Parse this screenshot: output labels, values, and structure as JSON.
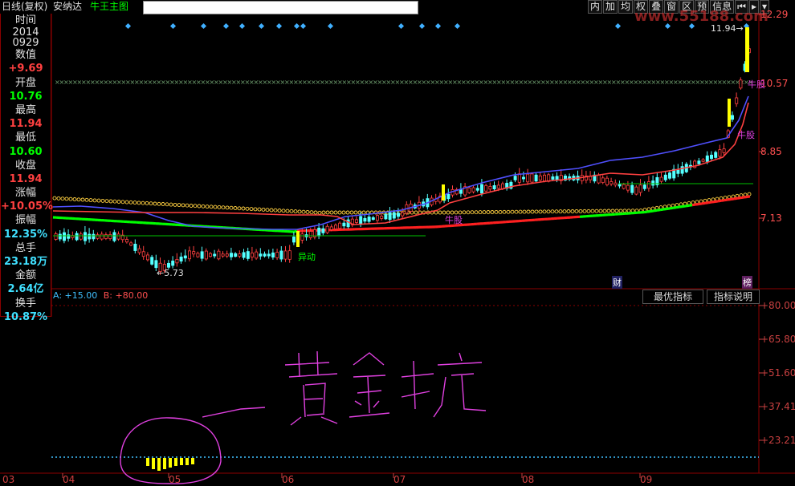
{
  "header": {
    "period": "日线(复权)",
    "stock_name": "安纳达",
    "indicator_name": "牛王主图",
    "search_value": "",
    "toolbar": [
      "内",
      "加",
      "均",
      "权",
      "叠",
      "窗",
      "区",
      "预",
      "信息"
    ],
    "watermark": "www.55188.com"
  },
  "info_panel": {
    "rows": [
      {
        "label": "时间",
        "value": "2014\n0929"
      },
      {
        "label": "数值",
        "value": "+9.69",
        "color": "#ff4040"
      },
      {
        "label": "开盘",
        "value": "10.76",
        "color": "#00ff00"
      },
      {
        "label": "最高",
        "value": "11.94",
        "color": "#ff4040"
      },
      {
        "label": "最低",
        "value": "10.60",
        "color": "#00ff00"
      },
      {
        "label": "收盘",
        "value": "11.94",
        "color": "#ff4040"
      },
      {
        "label": "涨幅",
        "value": "+10.05%",
        "color": "#ff4040"
      },
      {
        "label": "振幅",
        "value": "12.35%",
        "color": "#40e0ff"
      },
      {
        "label": "总手",
        "value": "23.18万",
        "color": "#40e0ff"
      },
      {
        "label": "金额",
        "value": "2.64亿",
        "color": "#40e0ff"
      },
      {
        "label": "换手",
        "value": "10.87%",
        "color": "#40e0ff"
      }
    ],
    "time_year": "2014",
    "time_date": "0929"
  },
  "price_axis": [
    "12.29",
    "10.57",
    "8.85",
    "7.13"
  ],
  "indicator_axis": [
    "+80.00",
    "+65.80",
    "+51.60",
    "+37.41",
    "+23.21"
  ],
  "date_axis": [
    "03",
    "04",
    "05",
    "06",
    "07",
    "08",
    "09"
  ],
  "annotations": {
    "high_label": "11.94",
    "low_label": "5.73",
    "yidong": "异动",
    "niugu1": "牛股",
    "niugu2": "牛股",
    "niugu3": "牛股",
    "cai": "财",
    "bang": "榜"
  },
  "indicator_values": {
    "a_label": "A:",
    "a_value": "+15.00",
    "b_label": "B:",
    "b_value": "+80.00"
  },
  "indicator_buttons": [
    "最优指标",
    "指标说明"
  ],
  "handwriting": "黄金坑",
  "colors": {
    "up": "#ff4040",
    "down": "#54ffff",
    "ma_red": "#ff4040",
    "ma_blue": "#5050ff",
    "ma_green": "#00ff00",
    "yellow": "#ffff00",
    "magenta": "#e040e0"
  }
}
